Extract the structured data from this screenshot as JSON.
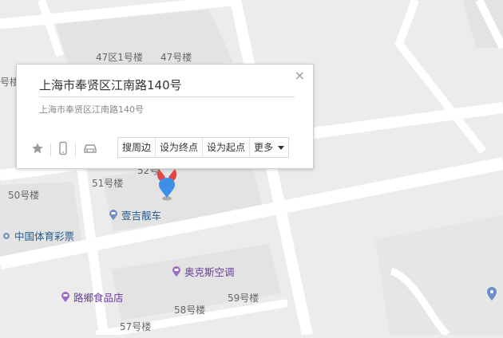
{
  "building_labels": {
    "b47_1": "47区1号楼",
    "b47": "47号楼",
    "b_left_top": "号楼",
    "b51": "51号楼",
    "b50": "50号楼",
    "b52": "52号",
    "b58": "58号楼",
    "b59": "59号楼",
    "b57": "57号楼"
  },
  "pois": {
    "yiji": "壹吉靓车",
    "lottery": "中国体育彩票",
    "aokesi": "奥克斯空调",
    "luxiang": "路鄉食品店"
  },
  "popup": {
    "title": "上海市奉贤区江南路140号",
    "address": "上海市奉贤区江南路140号",
    "close": "×",
    "buttons": {
      "nearby": "搜周边",
      "set_end": "设为终点",
      "set_start": "设为起点",
      "more": "更多"
    }
  },
  "colors": {
    "map_bg": "#ececec",
    "road": "#ffffff",
    "block": "#e3e3e3",
    "marker_blue": "#3d8fe8",
    "marker_red": "#e04848"
  }
}
